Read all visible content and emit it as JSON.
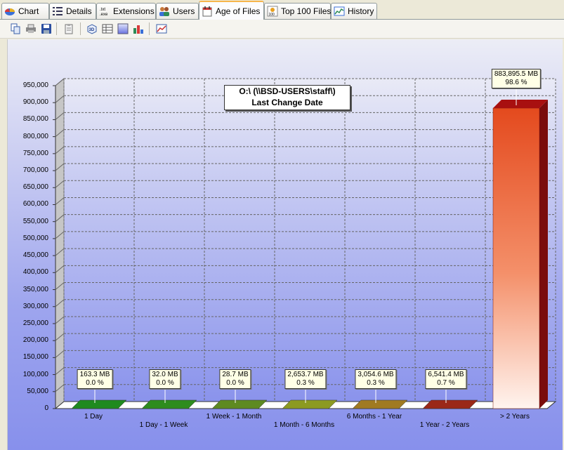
{
  "tabs": [
    {
      "label": "Chart",
      "icon": "pie-chart-icon",
      "active": false
    },
    {
      "label": "Details",
      "icon": "list-icon",
      "active": false
    },
    {
      "label": "Extensions",
      "icon": "txt-exe-icon",
      "active": false
    },
    {
      "label": "Users",
      "icon": "users-icon",
      "active": false
    },
    {
      "label": "Age of Files",
      "icon": "calendar-icon",
      "active": true
    },
    {
      "label": "Top 100 Files",
      "icon": "top100-icon",
      "active": false
    },
    {
      "label": "History",
      "icon": "history-chart-icon",
      "active": false
    }
  ],
  "toolbar": {
    "buttons": [
      "copy-icon",
      "print-icon",
      "save-icon",
      "clipboard-icon",
      "3d-toggle-icon",
      "grid-toggle-icon",
      "background-icon",
      "color-bars-icon",
      "chart-type-icon"
    ],
    "badge_3d": "3D"
  },
  "chart_data": {
    "type": "bar",
    "title_line1": "O:\\    (\\\\BSD-USERS\\staff\\)",
    "title_line2": "Last Change Date",
    "categories": [
      "1 Day",
      "1 Day - 1 Week",
      "1 Week - 1 Month",
      "1 Month - 6 Months",
      "6 Months - 1 Year",
      "1 Year - 2 Years",
      "> 2 Years"
    ],
    "values": [
      163.3,
      32.0,
      28.7,
      2653.7,
      3054.6,
      6541.4,
      883895.5
    ],
    "value_labels": [
      "163.3 MB",
      "32.0 MB",
      "28.7 MB",
      "2,653.7 MB",
      "3,054.6 MB",
      "6,541.4 MB",
      "883,895.5 MB"
    ],
    "percent_labels": [
      "0.0 %",
      "0.0 %",
      "0.0 %",
      "0.3 %",
      "0.3 %",
      "0.7 %",
      "98.6 %"
    ],
    "bar_colors": [
      "#1f8a1f",
      "#2e8c1e",
      "#5e8a22",
      "#8c9a22",
      "#a07a22",
      "#9a2818",
      "#e84820"
    ],
    "ylim": [
      0,
      950000
    ],
    "yticks": [
      0,
      50000,
      100000,
      150000,
      200000,
      250000,
      300000,
      350000,
      400000,
      450000,
      500000,
      550000,
      600000,
      650000,
      700000,
      750000,
      800000,
      850000,
      900000,
      950000
    ],
    "ytick_labels": [
      "0",
      "50,000",
      "100,000",
      "150,000",
      "200,000",
      "250,000",
      "300,000",
      "350,000",
      "400,000",
      "450,000",
      "500,000",
      "550,000",
      "600,000",
      "650,000",
      "700,000",
      "750,000",
      "800,000",
      "850,000",
      "900,000",
      "950,000"
    ],
    "grid": true,
    "view": "3D"
  }
}
